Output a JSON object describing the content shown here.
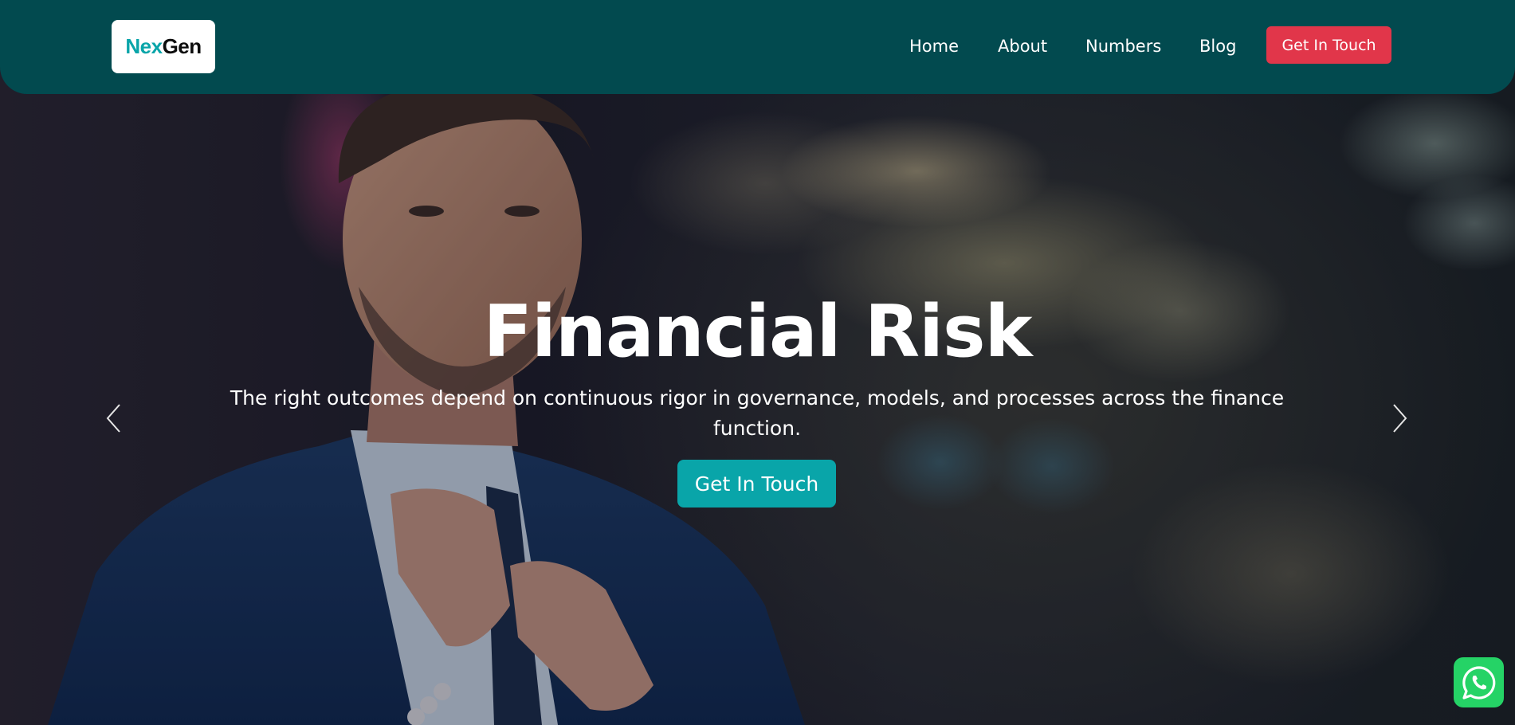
{
  "navbar": {
    "logo": {
      "part1": "Nex",
      "part2": "Gen"
    },
    "links": [
      {
        "label": "Home"
      },
      {
        "label": "About"
      },
      {
        "label": "Numbers"
      },
      {
        "label": "Blog"
      }
    ],
    "cta_label": "Get In Touch"
  },
  "hero": {
    "title": "Financial Risk",
    "subtitle": "The right outcomes depend on continuous rigor in governance, models, and processes across the finance function.",
    "cta_label": "Get In Touch",
    "prev_icon": "chevron-left-icon",
    "next_icon": "chevron-right-icon"
  },
  "floating": {
    "whatsapp_icon": "whatsapp-icon"
  },
  "colors": {
    "navbar_bg": "#024a4f",
    "brand_teal": "#09a5a9",
    "nav_cta_red": "#e1364a",
    "whatsapp_green": "#25d366"
  }
}
